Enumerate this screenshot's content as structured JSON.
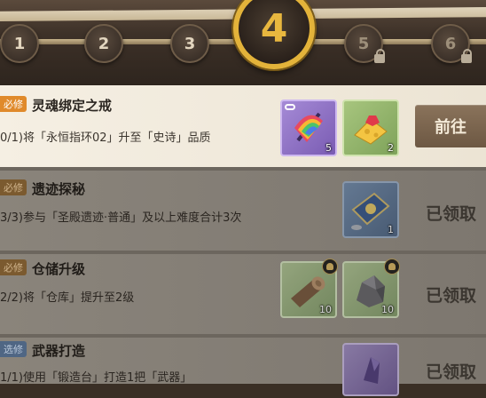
{
  "stages": [
    {
      "number": "1",
      "locked": false
    },
    {
      "number": "2",
      "locked": false
    },
    {
      "number": "3",
      "locked": false
    },
    {
      "number": "4",
      "current": true
    },
    {
      "number": "5",
      "locked": true
    },
    {
      "number": "6",
      "locked": true
    }
  ],
  "quests": [
    {
      "tag": "必修",
      "title": "灵魂绑定之戒",
      "desc": "0/1)将「永恒指环02」升至「史诗」品质",
      "rewards": [
        {
          "icon": "rainbow-fan-icon",
          "qty": "5"
        },
        {
          "icon": "cheese-gem-icon",
          "qty": "2"
        }
      ],
      "action": "前往"
    },
    {
      "tag": "必修",
      "title": "遗迹探秘",
      "desc": "3/3)参与「圣殿遗迹·普通」及以上难度合计3次",
      "rewards": [
        {
          "icon": "blue-ticket-icon",
          "qty": "1"
        }
      ],
      "status": "已领取"
    },
    {
      "tag": "必修",
      "title": "仓储升级",
      "desc": "2/2)将「仓库」提升至2级",
      "rewards": [
        {
          "icon": "wood-log-icon",
          "qty": "10"
        },
        {
          "icon": "stone-ore-icon",
          "qty": "10"
        }
      ],
      "status": "已领取"
    },
    {
      "tag": "选修",
      "title": "武器打造",
      "desc": "1/1)使用「锻造台」打造1把「武器」",
      "rewards": [
        {
          "icon": "purple-crystal-icon",
          "qty": ""
        }
      ],
      "status": "已领取"
    }
  ]
}
